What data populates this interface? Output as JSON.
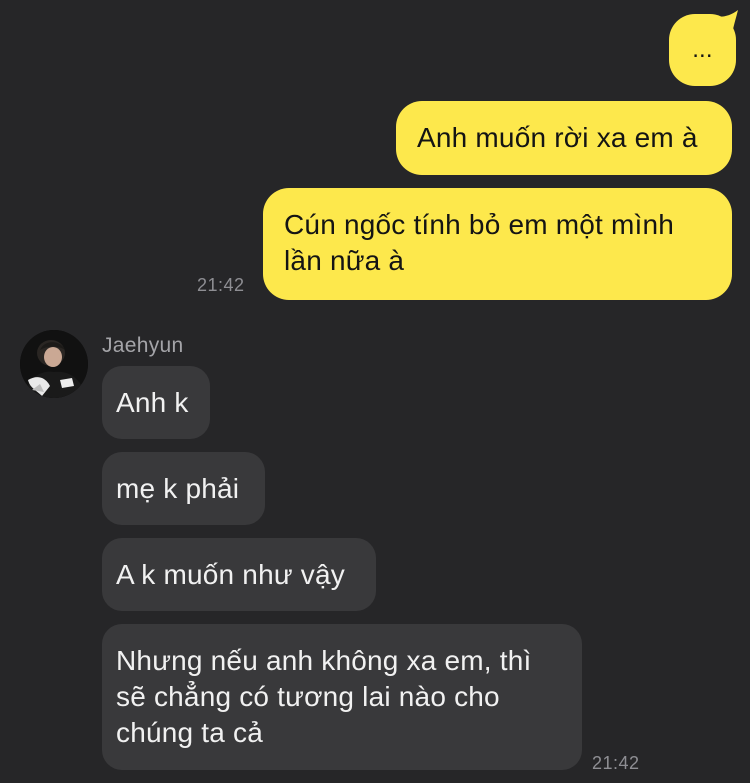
{
  "conversation": {
    "outgoing": [
      {
        "text": "..."
      },
      {
        "text": "Anh muốn rời xa em à"
      },
      {
        "lines": [
          "Cún ngốc tính bỏ em một mình",
          "lần nữa à"
        ]
      }
    ],
    "outgoing_time": "21:42",
    "contact": {
      "name": "Jaehyun",
      "avatar_icon": "profile-photo"
    },
    "incoming": [
      {
        "text": "Anh k"
      },
      {
        "text": "mẹ k phải"
      },
      {
        "text": "A k muốn như vậy"
      },
      {
        "lines": [
          "Nhưng nếu anh không xa em, thì",
          "sẽ chẳng có tương lai nào cho",
          "chúng ta cả"
        ]
      }
    ],
    "incoming_time": "21:42"
  },
  "colors": {
    "background": "#262628",
    "outgoing_bubble": "#fde84c",
    "incoming_bubble": "#39393b",
    "timestamp": "#8e8e93"
  }
}
